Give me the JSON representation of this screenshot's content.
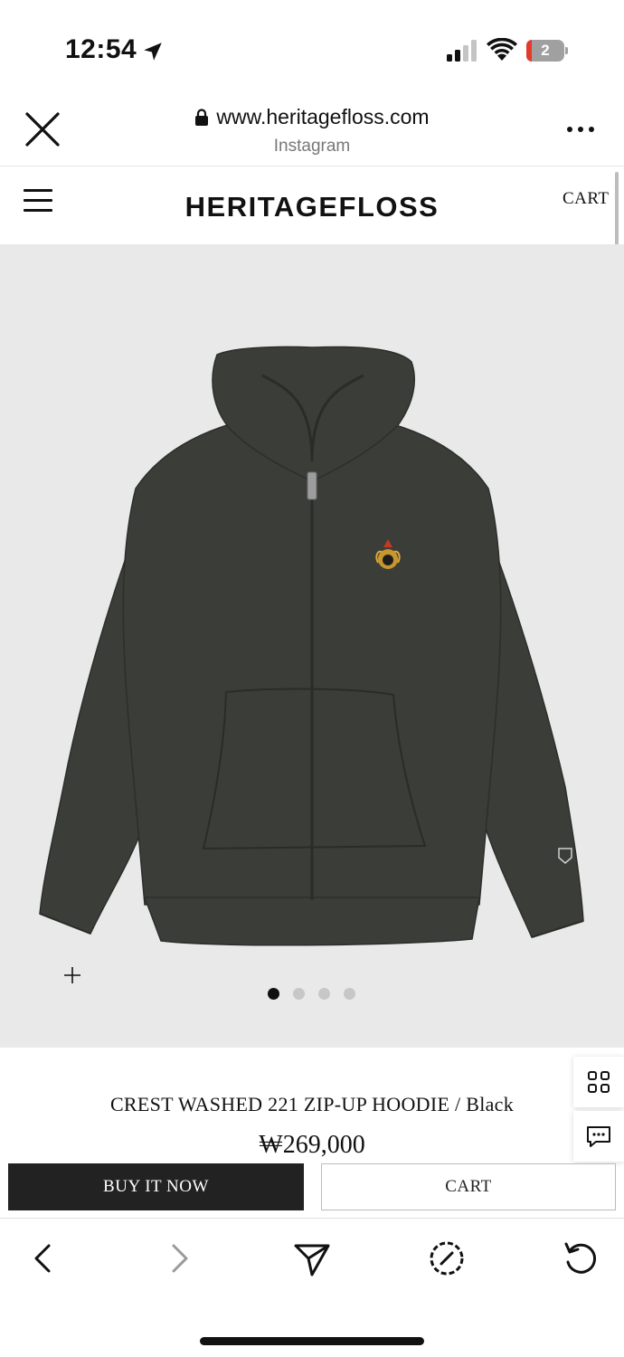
{
  "status_bar": {
    "time": "12:54",
    "battery_level": "2",
    "icons": [
      "location-arrow-icon",
      "cellular-signal-icon",
      "wifi-icon",
      "battery-icon"
    ]
  },
  "browser": {
    "url": "www.heritagefloss.com",
    "source": "Instagram",
    "icons": [
      "close-icon",
      "lock-icon",
      "more-icon"
    ]
  },
  "site": {
    "logo": "HERITAGEFLOSS",
    "cart_label": "CART",
    "icons": [
      "hamburger-menu-icon"
    ]
  },
  "gallery": {
    "image_count": 4,
    "active_index": 0,
    "icons": [
      "zoom-plus-icon"
    ]
  },
  "product": {
    "title": "CREST WASHED 221 ZIP-UP HOODIE / Black",
    "price": "₩269,000"
  },
  "floating": {
    "icons": [
      "grid-icon",
      "chat-icon"
    ]
  },
  "actions": {
    "buy_now": "BUY IT NOW",
    "cart": "CART"
  },
  "toolbar": {
    "icons": [
      "back-icon",
      "forward-icon",
      "share-icon",
      "safari-compass-icon",
      "reload-icon"
    ]
  },
  "colors": {
    "image_bg": "#e9e9e9",
    "hoodie": "#3b3d38",
    "buy_now_bg": "#222222"
  }
}
